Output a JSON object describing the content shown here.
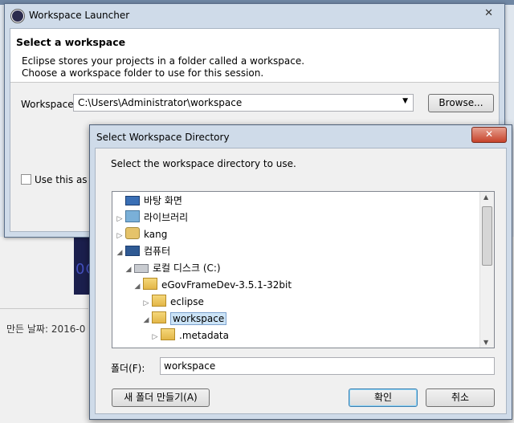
{
  "background": {
    "date_label": "만든 날짜: 2016-0",
    "dark_tile_text": "0C"
  },
  "launcher": {
    "title": "Workspace Launcher",
    "close_glyph": "✕",
    "header_title": "Select a workspace",
    "desc_line1": "Eclipse stores your projects in a folder called a workspace.",
    "desc_line2": "Choose a workspace folder to use for this session.",
    "workspace_label": "Workspace:",
    "workspace_value": "C:\\Users\\Administrator\\workspace",
    "browse_label": "Browse...",
    "use_default_label": "Use this as th"
  },
  "dialog": {
    "title": "Select Workspace Directory",
    "close_glyph": "✕",
    "description": "Select the workspace directory to use.",
    "tree": [
      {
        "label": "바탕 화면",
        "icon": "desktop-icon",
        "twisty": ""
      },
      {
        "label": "라이브러리",
        "icon": "library-icon",
        "twisty": "▷"
      },
      {
        "label": "kang",
        "icon": "user-icon",
        "twisty": "▷"
      },
      {
        "label": "컴퓨터",
        "icon": "computer-icon",
        "twisty": "◢"
      },
      {
        "label": "로컬 디스크 (C:)",
        "icon": "drive-icon",
        "twisty": "◢"
      },
      {
        "label": "eGovFrameDev-3.5.1-32bit",
        "icon": "folder-icon",
        "twisty": "◢"
      },
      {
        "label": "eclipse",
        "icon": "folder-icon",
        "twisty": "▷"
      },
      {
        "label": "workspace",
        "icon": "folder-icon",
        "twisty": "◢",
        "selected": true
      },
      {
        "label": ".metadata",
        "icon": "folder-icon",
        "twisty": "▷"
      }
    ],
    "folder_label": "폴더(F):",
    "folder_value": "workspace",
    "new_folder_label": "새 폴더 만들기(A)",
    "ok_label": "확인",
    "cancel_label": "취소"
  }
}
